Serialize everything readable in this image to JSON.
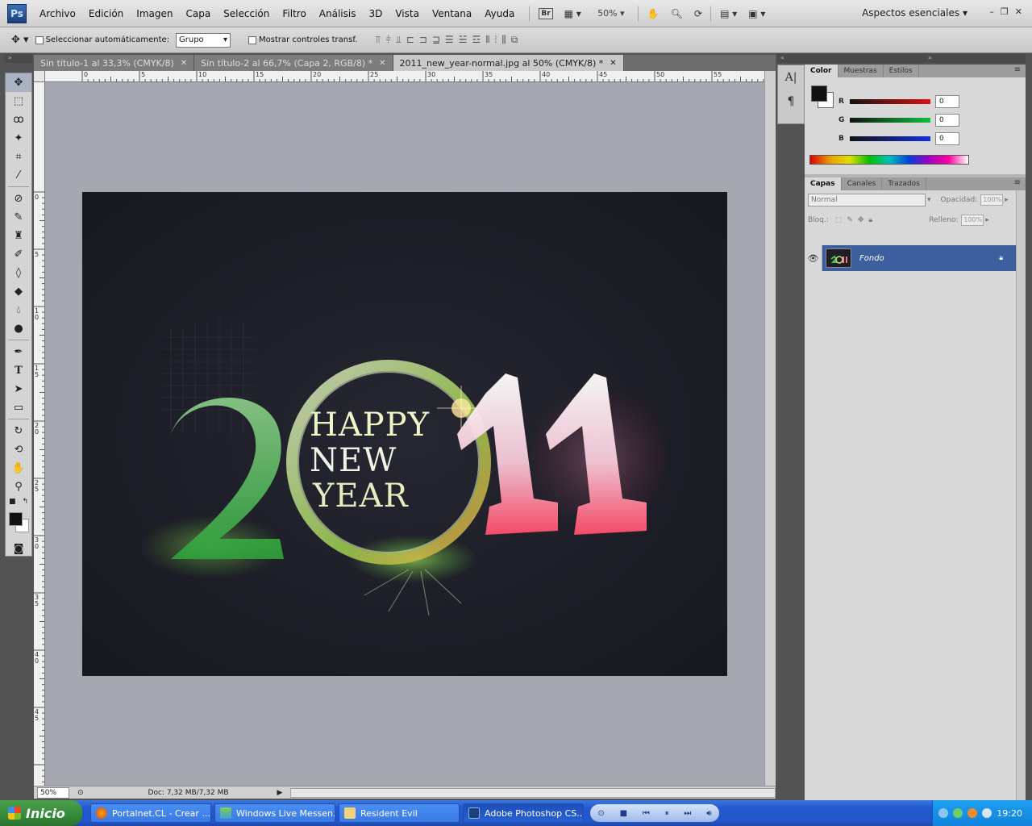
{
  "app": {
    "logo": "Ps",
    "menu": [
      "Archivo",
      "Edición",
      "Imagen",
      "Capa",
      "Selección",
      "Filtro",
      "Análisis",
      "3D",
      "Vista",
      "Ventana",
      "Ayuda"
    ],
    "bridge_label": "Br",
    "zoom_combo": "50%",
    "workspace": "Aspectos esenciales"
  },
  "options": {
    "auto_select_label": "Seleccionar automáticamente:",
    "auto_select_value": "Grupo",
    "show_transform_label": "Mostrar controles transf."
  },
  "tabs": [
    {
      "label": "Sin título-1 al 33,3% (CMYK/8)"
    },
    {
      "label": "Sin título-2 al 66,7% (Capa 2, RGB/8) *"
    },
    {
      "label": "2011_new_year-normal.jpg al 50% (CMYK/8) *"
    }
  ],
  "ruler_h": [
    "0",
    "5",
    "10",
    "15",
    "20",
    "25",
    "30",
    "35",
    "40",
    "45",
    "50",
    "55"
  ],
  "ruler_v": [
    "0",
    "5",
    "1 0",
    "1 5",
    "2 0",
    "2 5",
    "3 0",
    "3 5",
    "4 0",
    "4 5"
  ],
  "artwork": {
    "line1": "HAPPY",
    "line2": "NEW",
    "line3": "YEAR"
  },
  "status": {
    "zoom": "50%",
    "doc": "Doc: 7,32 MB/7,32 MB"
  },
  "color_panel": {
    "tabs": [
      "Color",
      "Muestras",
      "Estilos"
    ],
    "r_label": "R",
    "r_value": "0",
    "g_label": "G",
    "g_value": "0",
    "b_label": "B",
    "b_value": "0"
  },
  "layers_panel": {
    "tabs": [
      "Capas",
      "Canales",
      "Trazados"
    ],
    "blend_mode": "Normal",
    "opacity_label": "Opacidad:",
    "opacity_value": "100%",
    "lock_label": "Bloq.:",
    "fill_label": "Relleno:",
    "fill_value": "100%",
    "layer_name": "Fondo"
  },
  "taskbar": {
    "start": "Inicio",
    "buttons": [
      "Portalnet.CL - Crear ...",
      "Windows Live Messen...",
      "Resident Evil",
      "Adobe Photoshop CS..."
    ],
    "clock": "19:20"
  }
}
